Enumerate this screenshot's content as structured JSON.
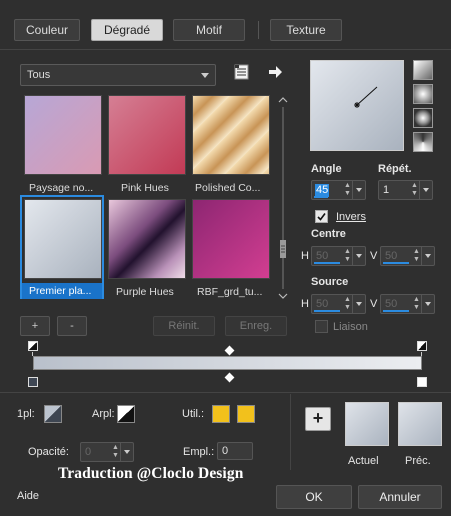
{
  "tabs": [
    {
      "label": "Couleur",
      "active": false
    },
    {
      "label": "Dégradé",
      "active": true
    },
    {
      "label": "Motif",
      "active": false
    },
    {
      "label": "Texture",
      "active": false
    }
  ],
  "category_dropdown": {
    "value": "Tous"
  },
  "gradients": [
    {
      "name": "Paysage no...",
      "colors": [
        "#b7a7d6",
        "#d99ab3"
      ],
      "selected": false
    },
    {
      "name": "Pink Hues",
      "colors": [
        "#d57f94",
        "#c23a55"
      ],
      "selected": false
    },
    {
      "name": "Polished Co...",
      "colors": [
        "#f3d8a4",
        "#b8874e"
      ],
      "selected": false
    },
    {
      "name": "Premier pla...",
      "colors": [
        "#e3e7ed",
        "#a9b2be"
      ],
      "selected": true
    },
    {
      "name": "Purple Hues",
      "colors": [
        "#2a1838",
        "#e3c1d8"
      ],
      "selected": false
    },
    {
      "name": "RBF_grd_tu...",
      "colors": [
        "#8d2672",
        "#d23e91"
      ],
      "selected": false
    }
  ],
  "list_buttons": {
    "add": "+",
    "remove": "-",
    "reset": "Réinit.",
    "save": "Enreg."
  },
  "angle": {
    "label": "Angle",
    "value": "45"
  },
  "repeat": {
    "label": "Répét.",
    "value": "1"
  },
  "invert": {
    "label": "Invers",
    "checked": true
  },
  "center": {
    "label": "Centre",
    "h_label": "H",
    "h_value": "50",
    "v_label": "V",
    "v_value": "50"
  },
  "source": {
    "label": "Source",
    "h_label": "H",
    "h_value": "50",
    "v_label": "V",
    "v_value": "50"
  },
  "link": {
    "label": "Liaison",
    "checked": false
  },
  "stops": {
    "label_1pl": "1pl:",
    "label_arpl": "Arpl:",
    "label_util": "Util.:",
    "util_color_1": "#f2c11c",
    "util_color_2": "#f2c11c"
  },
  "opacity": {
    "label": "Opacité:",
    "value": "0"
  },
  "location": {
    "label": "Empl.:",
    "value": "0"
  },
  "preview": {
    "current_label": "Actuel",
    "previous_label": "Préc."
  },
  "watermark": "Traduction @Cloclo Design",
  "footer": {
    "help": "Aide",
    "ok": "OK",
    "cancel": "Annuler"
  },
  "colors": {
    "accent": "#2b8be0",
    "selected_label": "#1a73c9"
  }
}
